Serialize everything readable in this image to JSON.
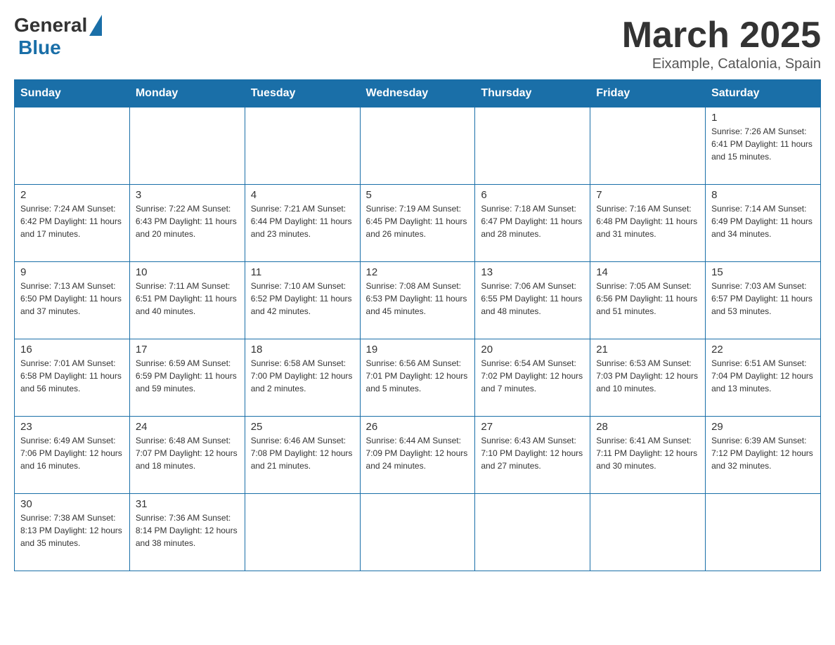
{
  "logo": {
    "general": "General",
    "blue": "Blue"
  },
  "title": {
    "month": "March 2025",
    "location": "Eixample, Catalonia, Spain"
  },
  "days_header": [
    "Sunday",
    "Monday",
    "Tuesday",
    "Wednesday",
    "Thursday",
    "Friday",
    "Saturday"
  ],
  "weeks": [
    [
      {
        "day": "",
        "info": ""
      },
      {
        "day": "",
        "info": ""
      },
      {
        "day": "",
        "info": ""
      },
      {
        "day": "",
        "info": ""
      },
      {
        "day": "",
        "info": ""
      },
      {
        "day": "",
        "info": ""
      },
      {
        "day": "1",
        "info": "Sunrise: 7:26 AM\nSunset: 6:41 PM\nDaylight: 11 hours and 15 minutes."
      }
    ],
    [
      {
        "day": "2",
        "info": "Sunrise: 7:24 AM\nSunset: 6:42 PM\nDaylight: 11 hours and 17 minutes."
      },
      {
        "day": "3",
        "info": "Sunrise: 7:22 AM\nSunset: 6:43 PM\nDaylight: 11 hours and 20 minutes."
      },
      {
        "day": "4",
        "info": "Sunrise: 7:21 AM\nSunset: 6:44 PM\nDaylight: 11 hours and 23 minutes."
      },
      {
        "day": "5",
        "info": "Sunrise: 7:19 AM\nSunset: 6:45 PM\nDaylight: 11 hours and 26 minutes."
      },
      {
        "day": "6",
        "info": "Sunrise: 7:18 AM\nSunset: 6:47 PM\nDaylight: 11 hours and 28 minutes."
      },
      {
        "day": "7",
        "info": "Sunrise: 7:16 AM\nSunset: 6:48 PM\nDaylight: 11 hours and 31 minutes."
      },
      {
        "day": "8",
        "info": "Sunrise: 7:14 AM\nSunset: 6:49 PM\nDaylight: 11 hours and 34 minutes."
      }
    ],
    [
      {
        "day": "9",
        "info": "Sunrise: 7:13 AM\nSunset: 6:50 PM\nDaylight: 11 hours and 37 minutes."
      },
      {
        "day": "10",
        "info": "Sunrise: 7:11 AM\nSunset: 6:51 PM\nDaylight: 11 hours and 40 minutes."
      },
      {
        "day": "11",
        "info": "Sunrise: 7:10 AM\nSunset: 6:52 PM\nDaylight: 11 hours and 42 minutes."
      },
      {
        "day": "12",
        "info": "Sunrise: 7:08 AM\nSunset: 6:53 PM\nDaylight: 11 hours and 45 minutes."
      },
      {
        "day": "13",
        "info": "Sunrise: 7:06 AM\nSunset: 6:55 PM\nDaylight: 11 hours and 48 minutes."
      },
      {
        "day": "14",
        "info": "Sunrise: 7:05 AM\nSunset: 6:56 PM\nDaylight: 11 hours and 51 minutes."
      },
      {
        "day": "15",
        "info": "Sunrise: 7:03 AM\nSunset: 6:57 PM\nDaylight: 11 hours and 53 minutes."
      }
    ],
    [
      {
        "day": "16",
        "info": "Sunrise: 7:01 AM\nSunset: 6:58 PM\nDaylight: 11 hours and 56 minutes."
      },
      {
        "day": "17",
        "info": "Sunrise: 6:59 AM\nSunset: 6:59 PM\nDaylight: 11 hours and 59 minutes."
      },
      {
        "day": "18",
        "info": "Sunrise: 6:58 AM\nSunset: 7:00 PM\nDaylight: 12 hours and 2 minutes."
      },
      {
        "day": "19",
        "info": "Sunrise: 6:56 AM\nSunset: 7:01 PM\nDaylight: 12 hours and 5 minutes."
      },
      {
        "day": "20",
        "info": "Sunrise: 6:54 AM\nSunset: 7:02 PM\nDaylight: 12 hours and 7 minutes."
      },
      {
        "day": "21",
        "info": "Sunrise: 6:53 AM\nSunset: 7:03 PM\nDaylight: 12 hours and 10 minutes."
      },
      {
        "day": "22",
        "info": "Sunrise: 6:51 AM\nSunset: 7:04 PM\nDaylight: 12 hours and 13 minutes."
      }
    ],
    [
      {
        "day": "23",
        "info": "Sunrise: 6:49 AM\nSunset: 7:06 PM\nDaylight: 12 hours and 16 minutes."
      },
      {
        "day": "24",
        "info": "Sunrise: 6:48 AM\nSunset: 7:07 PM\nDaylight: 12 hours and 18 minutes."
      },
      {
        "day": "25",
        "info": "Sunrise: 6:46 AM\nSunset: 7:08 PM\nDaylight: 12 hours and 21 minutes."
      },
      {
        "day": "26",
        "info": "Sunrise: 6:44 AM\nSunset: 7:09 PM\nDaylight: 12 hours and 24 minutes."
      },
      {
        "day": "27",
        "info": "Sunrise: 6:43 AM\nSunset: 7:10 PM\nDaylight: 12 hours and 27 minutes."
      },
      {
        "day": "28",
        "info": "Sunrise: 6:41 AM\nSunset: 7:11 PM\nDaylight: 12 hours and 30 minutes."
      },
      {
        "day": "29",
        "info": "Sunrise: 6:39 AM\nSunset: 7:12 PM\nDaylight: 12 hours and 32 minutes."
      }
    ],
    [
      {
        "day": "30",
        "info": "Sunrise: 7:38 AM\nSunset: 8:13 PM\nDaylight: 12 hours and 35 minutes."
      },
      {
        "day": "31",
        "info": "Sunrise: 7:36 AM\nSunset: 8:14 PM\nDaylight: 12 hours and 38 minutes."
      },
      {
        "day": "",
        "info": ""
      },
      {
        "day": "",
        "info": ""
      },
      {
        "day": "",
        "info": ""
      },
      {
        "day": "",
        "info": ""
      },
      {
        "day": "",
        "info": ""
      }
    ]
  ]
}
